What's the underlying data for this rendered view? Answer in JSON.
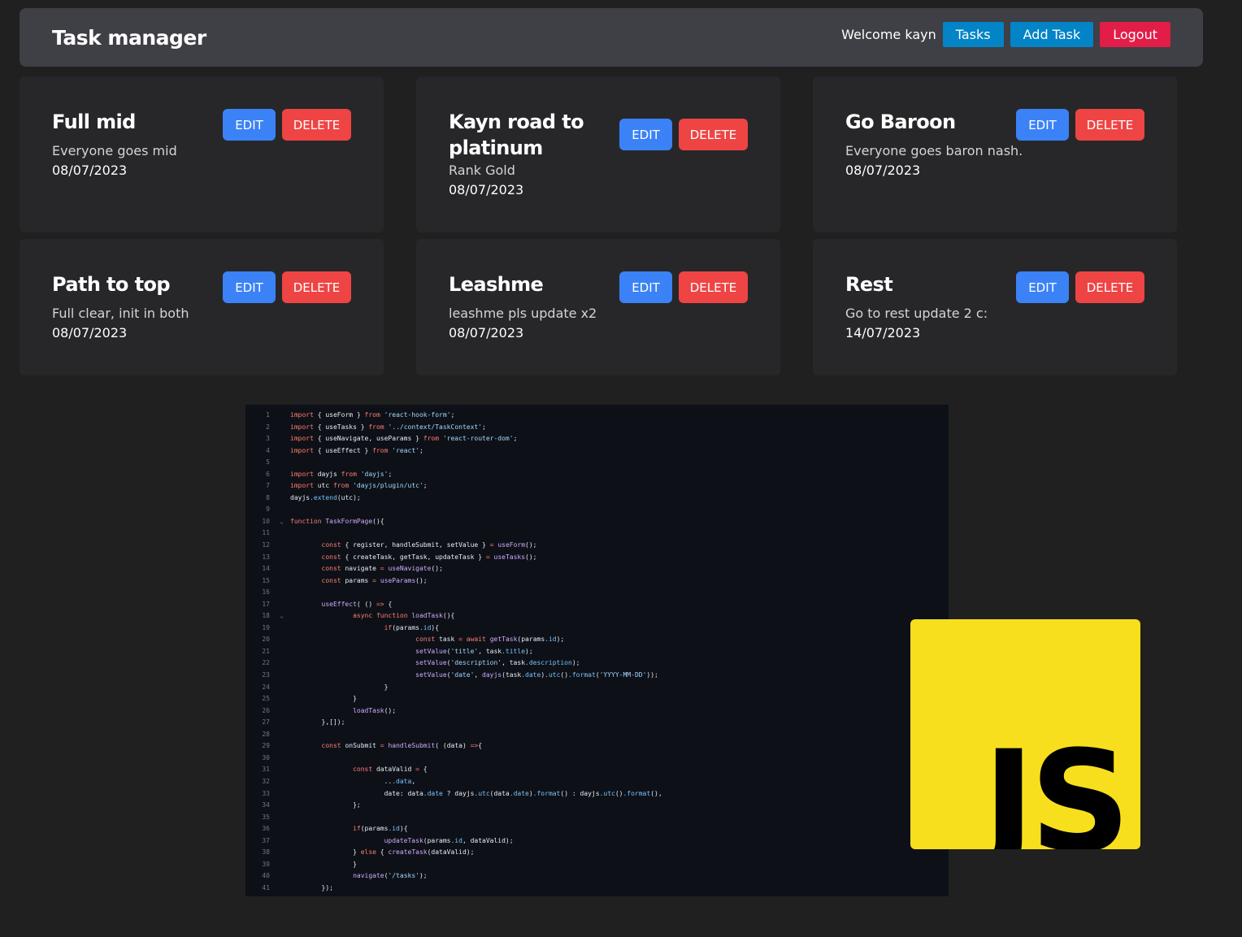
{
  "navbar": {
    "title": "Task manager",
    "welcome": "Welcome kayn",
    "tasks_label": "Tasks",
    "add_task_label": "Add Task",
    "logout_label": "Logout"
  },
  "tasks": [
    {
      "title": "Full mid",
      "description": "Everyone goes mid",
      "date": "08/07/2023",
      "edit_label": "EDIT",
      "delete_label": "DELETE"
    },
    {
      "title": "Kayn road to platinum",
      "description": "Rank Gold",
      "date": "08/07/2023",
      "edit_label": "EDIT",
      "delete_label": "DELETE"
    },
    {
      "title": "Go Baroon",
      "description": "Everyone goes baron nash.",
      "date": "08/07/2023",
      "edit_label": "EDIT",
      "delete_label": "DELETE"
    },
    {
      "title": "Path to top",
      "description": "Full clear, init in both",
      "date": "08/07/2023",
      "edit_label": "EDIT",
      "delete_label": "DELETE"
    },
    {
      "title": "Leashme",
      "description": "leashme pls update x2",
      "date": "08/07/2023",
      "edit_label": "EDIT",
      "delete_label": "DELETE"
    },
    {
      "title": "Rest",
      "description": "Go to rest update 2 c:",
      "date": "14/07/2023",
      "edit_label": "EDIT",
      "delete_label": "DELETE"
    }
  ],
  "code_image": {
    "lines": [
      "import { useForm } from 'react-hook-form';",
      "import { useTasks } from '../context/TaskContext';",
      "import { useNavigate, useParams } from 'react-router-dom';",
      "import { useEffect } from 'react';",
      "",
      "import dayjs from 'dayjs';",
      "import utc from 'dayjs/plugin/utc';",
      "dayjs.extend(utc);",
      "",
      "function TaskFormPage(){",
      "",
      "        const { register, handleSubmit, setValue } = useForm();",
      "        const { createTask, getTask, updateTask } = useTasks();",
      "        const navigate = useNavigate();",
      "        const params = useParams();",
      "",
      "        useEffect( () => {",
      "                async function loadTask(){",
      "                        if(params.id){",
      "                                const task = await getTask(params.id);",
      "                                setValue('title', task.title);",
      "                                setValue('description', task.description);",
      "                                setValue('date', dayjs(task.date).utc().format('YYYY-MM-DD'));",
      "                        }",
      "                }",
      "                loadTask();",
      "        },[]);",
      "",
      "        const onSubmit = handleSubmit( (data) =>{",
      "",
      "                const dataValid = {",
      "                        ...data,",
      "                        date: data.date ? dayjs.utc(data.date).format() : dayjs.utc().format(),",
      "                };",
      "",
      "                if(params.id){",
      "                        updateTask(params.id, dataValid);",
      "                } else { createTask(dataValid);",
      "                }",
      "                navigate('/tasks');",
      "        });"
    ],
    "folded_lines": [
      10,
      18
    ]
  },
  "js_logo": {
    "text": "JS",
    "color": "#f7df1e"
  }
}
